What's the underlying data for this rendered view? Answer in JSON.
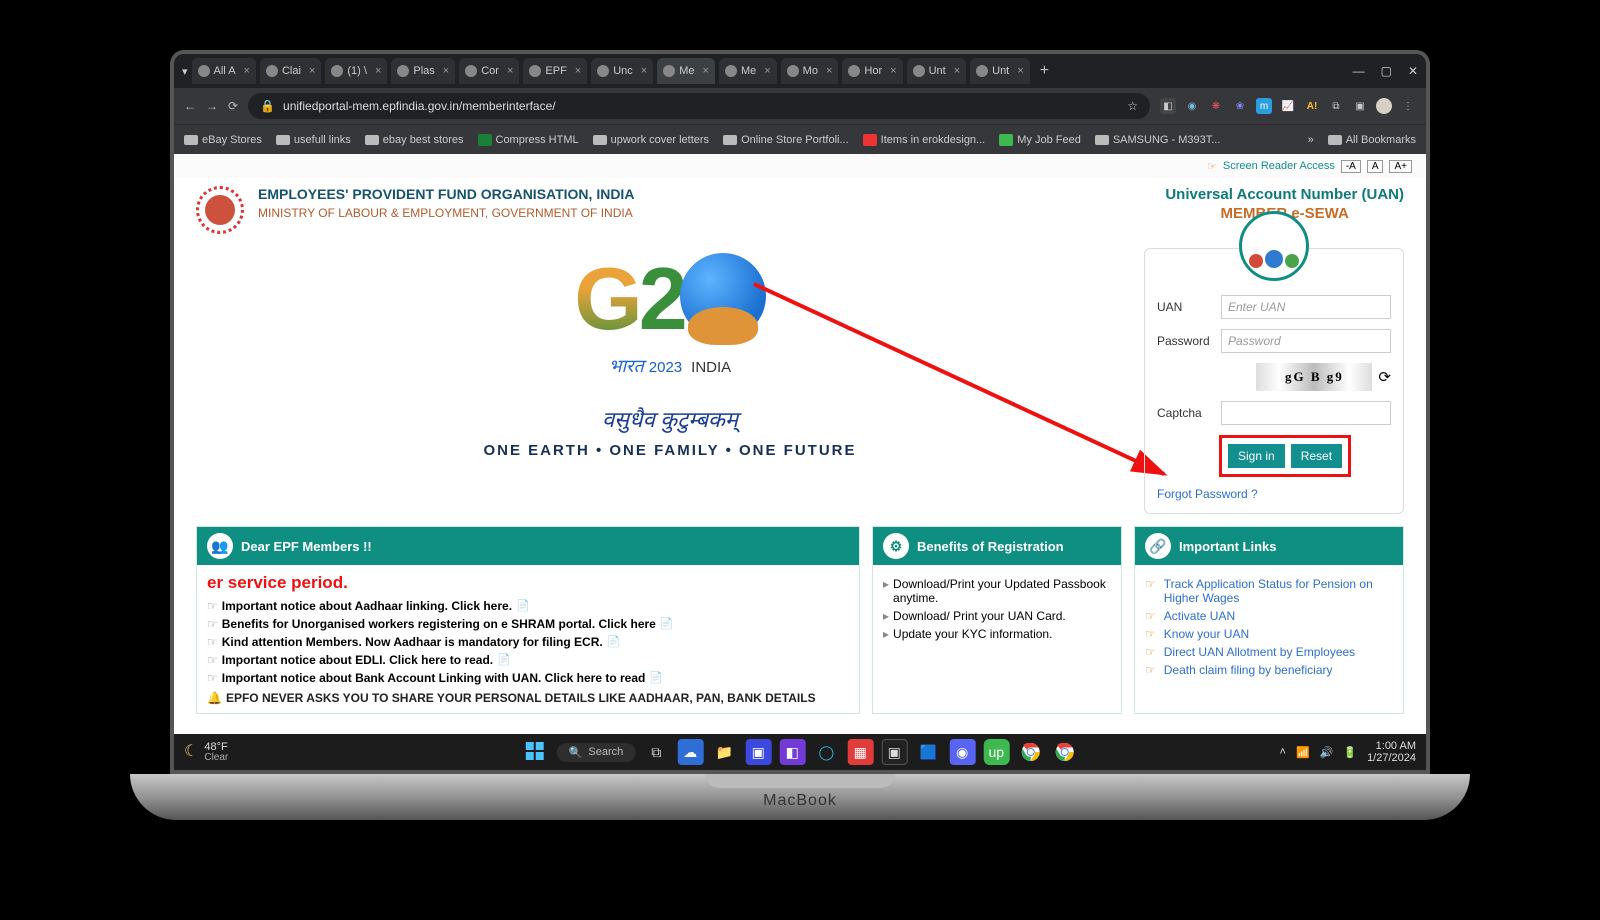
{
  "browser": {
    "tabs": [
      {
        "label": "All A"
      },
      {
        "label": "Clai"
      },
      {
        "label": "(1) \\"
      },
      {
        "label": "Plas"
      },
      {
        "label": "Cor"
      },
      {
        "label": "EPF"
      },
      {
        "label": "Unc"
      },
      {
        "label": "Me",
        "active": true
      },
      {
        "label": "Me"
      },
      {
        "label": "Mo"
      },
      {
        "label": "Hor"
      },
      {
        "label": "Unt"
      },
      {
        "label": "Unt"
      }
    ],
    "url": "unifiedportal-mem.epfindia.gov.in/memberinterface/",
    "bookmarks": [
      "eBay Stores",
      "usefull links",
      "ebay best stores",
      "Compress HTML",
      "upwork cover letters",
      "Online Store Portfoli...",
      "Items in erokdesign...",
      "My Job Feed",
      "SAMSUNG - M393T..."
    ],
    "bookmarks_more": "»",
    "all_bookmarks": "All Bookmarks",
    "win_controls": {
      "min": "—",
      "max": "▢",
      "close": "✕"
    }
  },
  "topbar": {
    "screen_reader": "Screen Reader Access",
    "font_small": "-A",
    "font_mid": "A",
    "font_large": "A+"
  },
  "header": {
    "org": "EMPLOYEES' PROVIDENT FUND ORGANISATION, INDIA",
    "sub": "MINISTRY OF LABOUR & EMPLOYMENT, GOVERNMENT OF INDIA",
    "uan_title": "Universal Account Number (UAN)",
    "esewa": "MEMBER e-SEWA"
  },
  "g20": {
    "year": "2023",
    "india": "INDIA",
    "bharat": "भारत",
    "line2": "वसुधैव कुटुम्बकम्",
    "line3": "ONE EARTH • ONE FAMILY • ONE FUTURE"
  },
  "login": {
    "uan_label": "UAN",
    "uan_ph": "Enter UAN",
    "pwd_label": "Password",
    "pwd_ph": "Password",
    "captcha_label": "Captcha",
    "captcha_text": "gG B g9",
    "signin": "Sign in",
    "reset": "Reset",
    "forgot": "Forgot Password ?"
  },
  "panels": {
    "a_title": "Dear EPF Members !!",
    "a_marquee": "er service period.",
    "a_items": [
      "Important notice about Aadhaar linking. Click here.",
      "Benefits for Unorganised workers registering on e SHRAM portal. Click here",
      "Kind attention Members. Now Aadhaar is mandatory for filing ECR.",
      "Important notice about EDLI. Click here to read.",
      "Important notice about Bank Account Linking with UAN. Click here to read"
    ],
    "a_warn": "EPFO NEVER ASKS YOU TO SHARE YOUR PERSONAL DETAILS LIKE AADHAAR, PAN, BANK DETAILS",
    "b_title": "Benefits of Registration",
    "b_items": [
      "Download/Print your Updated Passbook anytime.",
      "Download/ Print your UAN Card.",
      "Update your KYC information."
    ],
    "c_title": "Important Links",
    "c_items": [
      "Track Application Status for Pension on Higher Wages",
      "Activate UAN",
      "Know your UAN",
      "Direct UAN Allotment by Employees",
      "Death claim filing by beneficiary"
    ]
  },
  "taskbar": {
    "temp": "48°F",
    "cond": "Clear",
    "search_label": "Search",
    "time": "1:00 AM",
    "date": "1/27/2024"
  },
  "laptop_brand": "MacBook",
  "colors": {
    "accent": "#0f8f82",
    "annot": "#e11"
  }
}
